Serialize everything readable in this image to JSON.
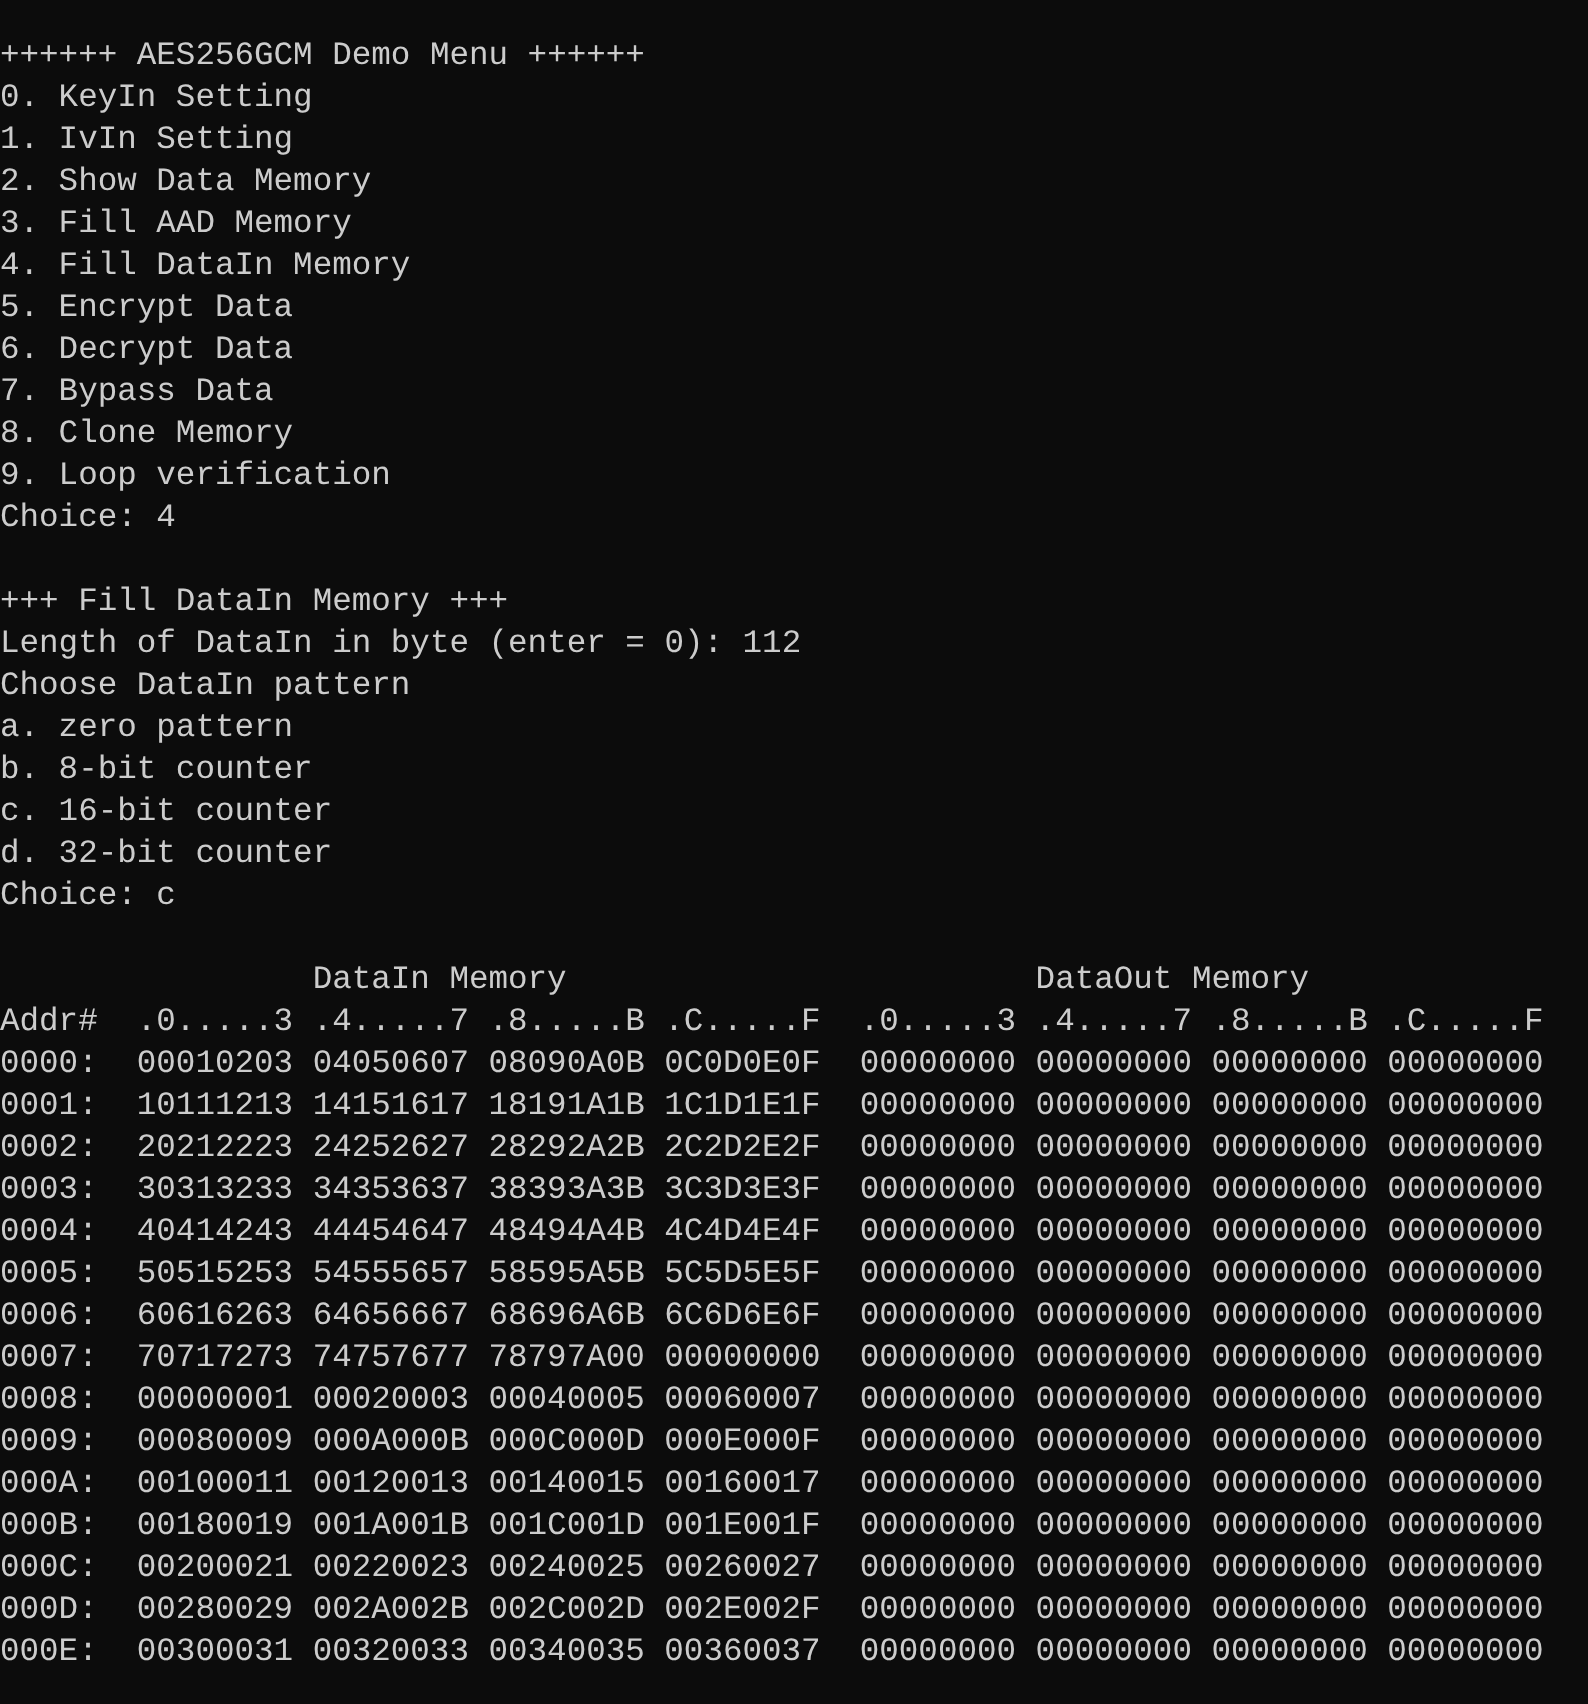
{
  "menu": {
    "title": "++++++ AES256GCM Demo Menu ++++++",
    "items": [
      "0. KeyIn Setting",
      "1. IvIn Setting",
      "2. Show Data Memory",
      "3. Fill AAD Memory",
      "4. Fill DataIn Memory",
      "5. Encrypt Data",
      "6. Decrypt Data",
      "7. Bypass Data",
      "8. Clone Memory",
      "9. Loop verification"
    ],
    "choice": "Choice: 4"
  },
  "fill_section": {
    "title": "+++ Fill DataIn Memory +++",
    "length_prompt": "Length of DataIn in byte (enter = 0): 112",
    "pattern_prompt": "Choose DataIn pattern",
    "options": [
      "a. zero pattern",
      "b. 8-bit counter",
      "c. 16-bit counter",
      "d. 32-bit counter"
    ],
    "choice": "Choice: c"
  },
  "memory_table": {
    "datain_title": "DataIn Memory",
    "dataout_title": "DataOut Memory",
    "addr_header": "Addr#",
    "datain_columns": [
      ".0.....3",
      ".4.....7",
      ".8.....B",
      ".C.....F"
    ],
    "dataout_columns": [
      ".0.....3",
      ".4.....7",
      ".8.....B",
      ".C.....F"
    ],
    "rows": [
      {
        "addr": "0000:",
        "datain": [
          "00010203",
          "04050607",
          "08090A0B",
          "0C0D0E0F"
        ],
        "dataout": [
          "00000000",
          "00000000",
          "00000000",
          "00000000"
        ]
      },
      {
        "addr": "0001:",
        "datain": [
          "10111213",
          "14151617",
          "18191A1B",
          "1C1D1E1F"
        ],
        "dataout": [
          "00000000",
          "00000000",
          "00000000",
          "00000000"
        ]
      },
      {
        "addr": "0002:",
        "datain": [
          "20212223",
          "24252627",
          "28292A2B",
          "2C2D2E2F"
        ],
        "dataout": [
          "00000000",
          "00000000",
          "00000000",
          "00000000"
        ]
      },
      {
        "addr": "0003:",
        "datain": [
          "30313233",
          "34353637",
          "38393A3B",
          "3C3D3E3F"
        ],
        "dataout": [
          "00000000",
          "00000000",
          "00000000",
          "00000000"
        ]
      },
      {
        "addr": "0004:",
        "datain": [
          "40414243",
          "44454647",
          "48494A4B",
          "4C4D4E4F"
        ],
        "dataout": [
          "00000000",
          "00000000",
          "00000000",
          "00000000"
        ]
      },
      {
        "addr": "0005:",
        "datain": [
          "50515253",
          "54555657",
          "58595A5B",
          "5C5D5E5F"
        ],
        "dataout": [
          "00000000",
          "00000000",
          "00000000",
          "00000000"
        ]
      },
      {
        "addr": "0006:",
        "datain": [
          "60616263",
          "64656667",
          "68696A6B",
          "6C6D6E6F"
        ],
        "dataout": [
          "00000000",
          "00000000",
          "00000000",
          "00000000"
        ]
      },
      {
        "addr": "0007:",
        "datain": [
          "70717273",
          "74757677",
          "78797A00",
          "00000000"
        ],
        "dataout": [
          "00000000",
          "00000000",
          "00000000",
          "00000000"
        ]
      },
      {
        "addr": "0008:",
        "datain": [
          "00000001",
          "00020003",
          "00040005",
          "00060007"
        ],
        "dataout": [
          "00000000",
          "00000000",
          "00000000",
          "00000000"
        ]
      },
      {
        "addr": "0009:",
        "datain": [
          "00080009",
          "000A000B",
          "000C000D",
          "000E000F"
        ],
        "dataout": [
          "00000000",
          "00000000",
          "00000000",
          "00000000"
        ]
      },
      {
        "addr": "000A:",
        "datain": [
          "00100011",
          "00120013",
          "00140015",
          "00160017"
        ],
        "dataout": [
          "00000000",
          "00000000",
          "00000000",
          "00000000"
        ]
      },
      {
        "addr": "000B:",
        "datain": [
          "00180019",
          "001A001B",
          "001C001D",
          "001E001F"
        ],
        "dataout": [
          "00000000",
          "00000000",
          "00000000",
          "00000000"
        ]
      },
      {
        "addr": "000C:",
        "datain": [
          "00200021",
          "00220023",
          "00240025",
          "00260027"
        ],
        "dataout": [
          "00000000",
          "00000000",
          "00000000",
          "00000000"
        ]
      },
      {
        "addr": "000D:",
        "datain": [
          "00280029",
          "002A002B",
          "002C002D",
          "002E002F"
        ],
        "dataout": [
          "00000000",
          "00000000",
          "00000000",
          "00000000"
        ]
      },
      {
        "addr": "000E:",
        "datain": [
          "00300031",
          "00320033",
          "00340035",
          "00360037"
        ],
        "dataout": [
          "00000000",
          "00000000",
          "00000000",
          "00000000"
        ]
      }
    ]
  }
}
